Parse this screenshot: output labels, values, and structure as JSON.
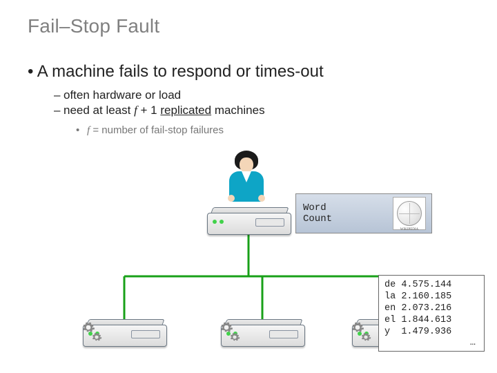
{
  "title": "Fail–Stop Fault",
  "bullet1_prefix": "•  ",
  "bullet1": "A machine fails to respond or times-out",
  "bullet2a_prefix": "–  ",
  "bullet2a": "often hardware or load",
  "bullet2b_prefix": "–  ",
  "bullet2b_before": "need at least ",
  "bullet2b_f": "f",
  "bullet2b_after": " + 1 ",
  "bullet2b_underlined": "replicated",
  "bullet2b_tail": " machines",
  "bullet3_prefix": "•  ",
  "bullet3_f": "f",
  "bullet3_rest": " = number of fail-stop failures",
  "card": {
    "label": "Word\nCount",
    "logo_name": "wikipedia-logo",
    "logo_caption": "WIKIPEDIA"
  },
  "results": {
    "rows": [
      {
        "code": "de",
        "value": "4.575.144"
      },
      {
        "code": "la",
        "value": "2.160.185"
      },
      {
        "code": "en",
        "value": "2.073.216"
      },
      {
        "code": "el",
        "value": "1.844.613"
      },
      {
        "code": "y",
        "value": "1.479.936"
      }
    ],
    "more": "…"
  },
  "colors": {
    "wire": "#18a018"
  }
}
